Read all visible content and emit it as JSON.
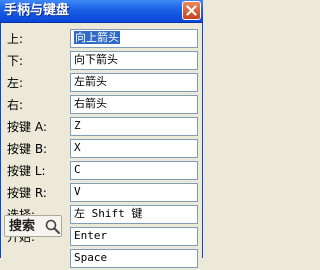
{
  "window": {
    "title": "手柄与键盘"
  },
  "bindings": [
    {
      "label": "上:",
      "value": "向上箭头",
      "selected": true
    },
    {
      "label": "下:",
      "value": "向下箭头"
    },
    {
      "label": "左:",
      "value": "左箭头"
    },
    {
      "label": "右:",
      "value": "右箭头"
    },
    {
      "label": "按键 A:",
      "value": "Z"
    },
    {
      "label": "按键 B:",
      "value": "X"
    },
    {
      "label": "按键 L:",
      "value": "C"
    },
    {
      "label": "按键 R:",
      "value": "V"
    },
    {
      "label": "选择:",
      "value": "左 Shift 键"
    },
    {
      "label": "开始:",
      "value": "Enter"
    },
    {
      "label": "",
      "value": "Space"
    }
  ],
  "search": {
    "label": "搜索"
  }
}
